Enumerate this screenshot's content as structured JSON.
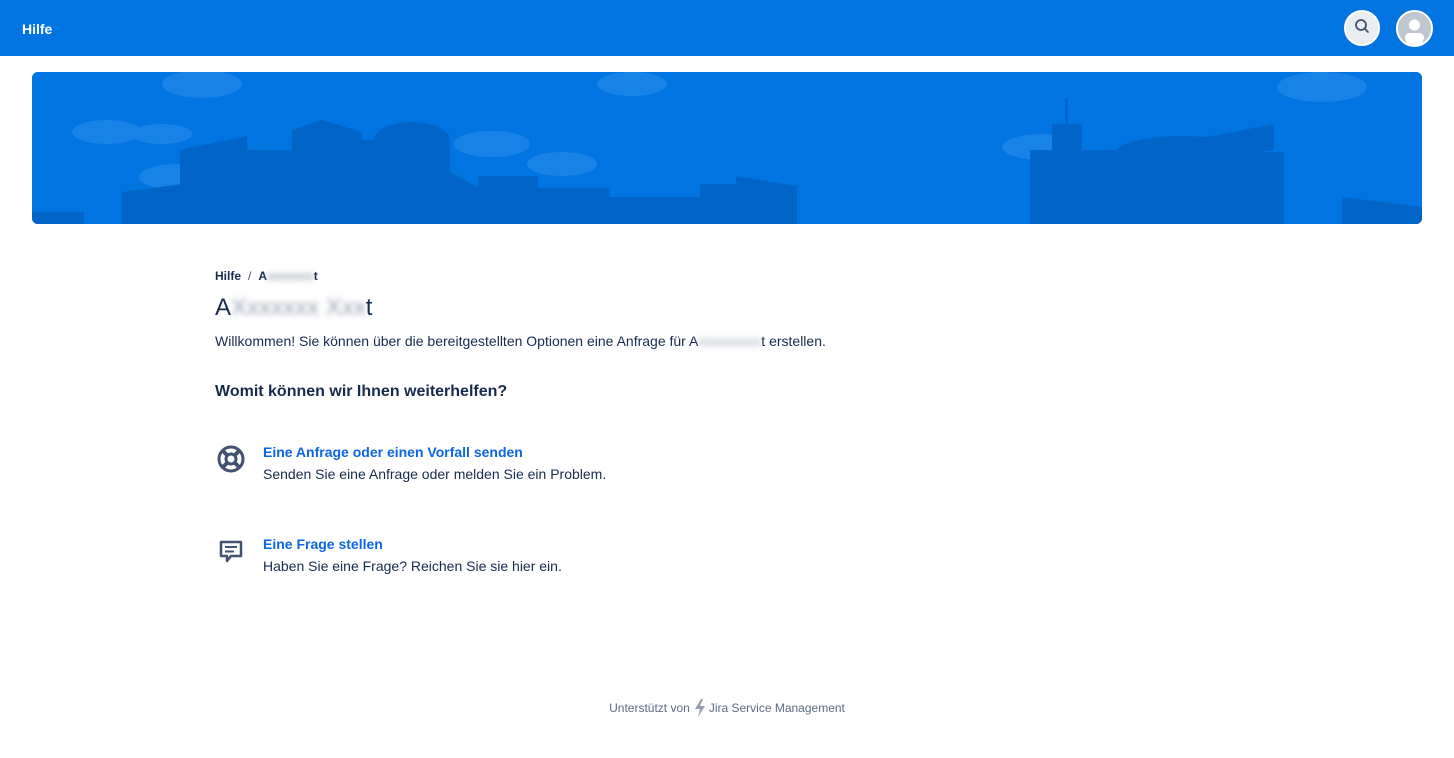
{
  "header": {
    "home_label": "Hilfe",
    "search_icon": "search-icon",
    "avatar_icon": "user-avatar-icon",
    "color": "#0074e0"
  },
  "breadcrumb": {
    "root": "Hilfe",
    "separator": "/",
    "current_prefix": "A",
    "current_blur": "xxxxxxx",
    "current_suffix": "t"
  },
  "portal": {
    "title_prefix": "A",
    "title_blur": "Xxxxxxx Xxx",
    "title_suffix": "t",
    "welcome_before": "Willkommen! Sie können über die bereitgestellten Optionen eine Anfrage für A",
    "welcome_blur": "xxxxxxxxx",
    "welcome_after": "t erstellen."
  },
  "help_section": {
    "heading": "Womit können wir Ihnen weiterhelfen?",
    "options": [
      {
        "icon": "lifebuoy-icon",
        "title": "Eine Anfrage oder einen Vorfall senden",
        "description": "Senden Sie eine Anfrage oder melden Sie ein Problem."
      },
      {
        "icon": "chat-icon",
        "title": "Eine Frage stellen",
        "description": "Haben Sie eine Frage? Reichen Sie sie hier ein."
      }
    ]
  },
  "footer": {
    "prefix": "Unterstützt von",
    "product": "Jira Service Management",
    "icon": "jira-bolt-icon"
  },
  "colors": {
    "primary": "#0074e0",
    "link": "#0c66e4",
    "text": "#172b4d"
  }
}
